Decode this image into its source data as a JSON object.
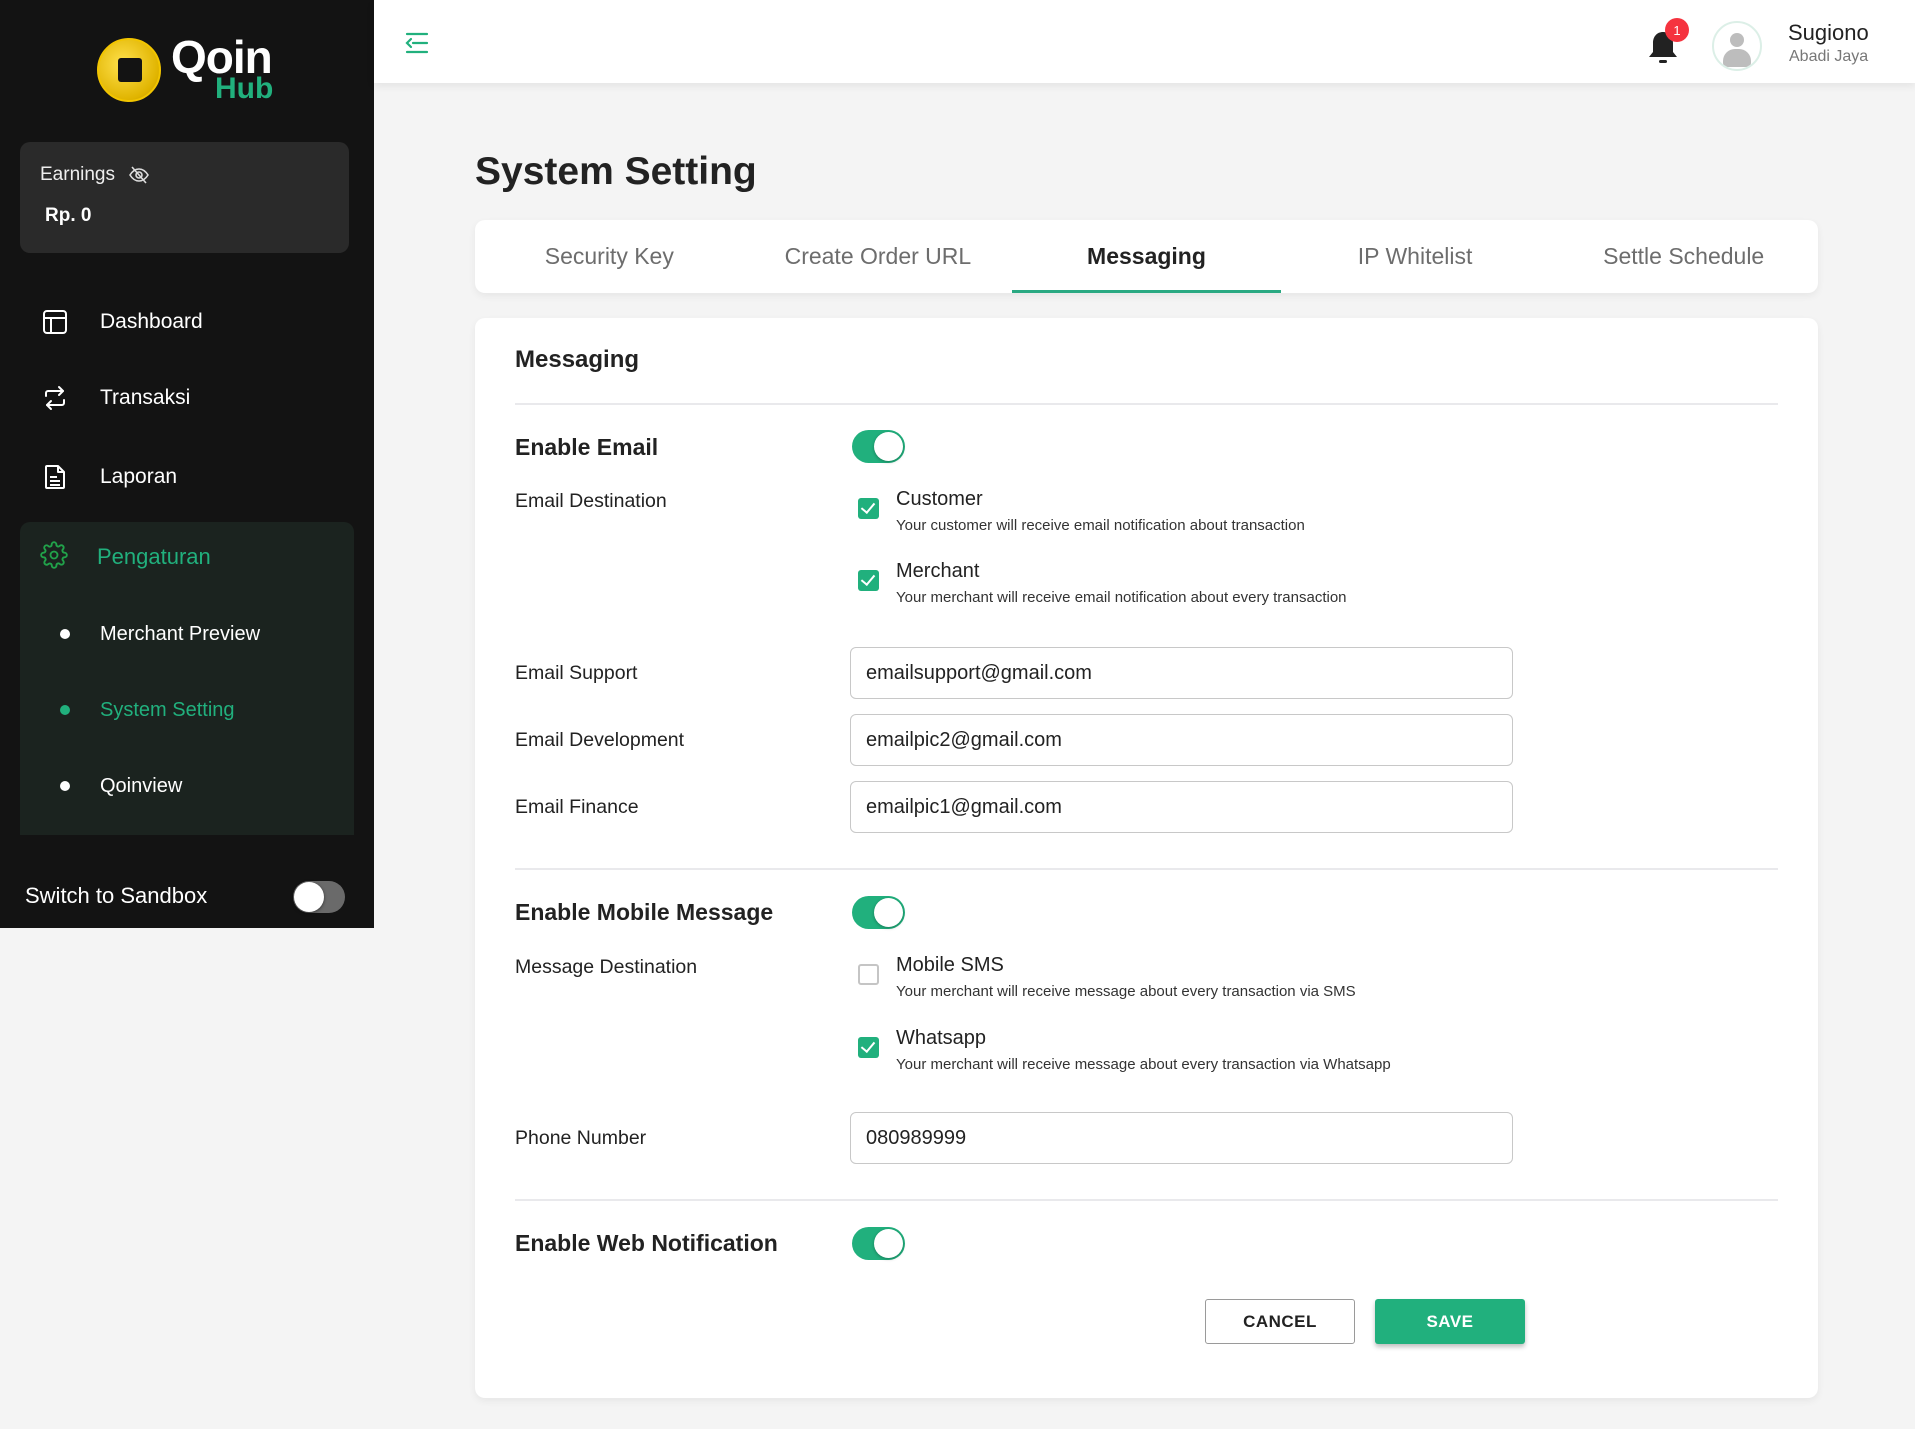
{
  "brand": {
    "name": "Qoin",
    "sub": "Hub"
  },
  "earnings": {
    "label": "Earnings",
    "value": "Rp. 0",
    "visibility_icon": "eye-off-icon"
  },
  "sidebar": {
    "items": [
      {
        "label": "Dashboard",
        "icon": "dashboard-icon"
      },
      {
        "label": "Transaksi",
        "icon": "transfer-icon"
      },
      {
        "label": "Laporan",
        "icon": "document-icon"
      }
    ],
    "group": {
      "label": "Pengaturan",
      "icon": "gear-icon",
      "children": [
        {
          "label": "Merchant Preview",
          "active": false
        },
        {
          "label": "System Setting",
          "active": true
        },
        {
          "label": "Qoinview",
          "active": false
        }
      ]
    },
    "sandbox": {
      "label": "Switch to Sandbox",
      "enabled": false
    }
  },
  "header": {
    "notifications": {
      "count": "1"
    },
    "user": {
      "name": "Sugiono",
      "org": "Abadi Jaya"
    }
  },
  "page": {
    "title": "System Setting"
  },
  "tabs": [
    {
      "label": "Security Key",
      "active": false
    },
    {
      "label": "Create Order URL",
      "active": false
    },
    {
      "label": "Messaging",
      "active": true
    },
    {
      "label": "IP Whitelist",
      "active": false
    },
    {
      "label": "Settle Schedule",
      "active": false
    }
  ],
  "messaging": {
    "title": "Messaging",
    "email": {
      "label": "Enable Email",
      "enabled": true,
      "destination_label": "Email Destination",
      "destinations": [
        {
          "title": "Customer",
          "desc": "Your customer will receive email notification about transaction",
          "checked": true
        },
        {
          "title": "Merchant",
          "desc": "Your merchant will receive email notification about every transaction",
          "checked": true
        }
      ],
      "fields": [
        {
          "label": "Email Support",
          "value": "emailsupport@gmail.com"
        },
        {
          "label": "Email Development",
          "value": "emailpic2@gmail.com"
        },
        {
          "label": "Email Finance",
          "value": "emailpic1@gmail.com"
        }
      ]
    },
    "mobile": {
      "label": "Enable Mobile Message",
      "enabled": true,
      "destination_label": "Message Destination",
      "destinations": [
        {
          "title": "Mobile SMS",
          "desc": "Your merchant will receive message about every transaction via SMS",
          "checked": false
        },
        {
          "title": "Whatsapp",
          "desc": "Your merchant will receive message about every transaction via Whatsapp",
          "checked": true
        }
      ],
      "phone": {
        "label": "Phone Number",
        "value": "080989999"
      }
    },
    "web": {
      "label": "Enable Web Notification",
      "enabled": true
    },
    "actions": {
      "cancel": "CANCEL",
      "save": "SAVE"
    }
  },
  "colors": {
    "accent": "#21b07d",
    "sidebar_bg": "#131313",
    "badge": "#f5333f",
    "coin": "#f2c500"
  }
}
